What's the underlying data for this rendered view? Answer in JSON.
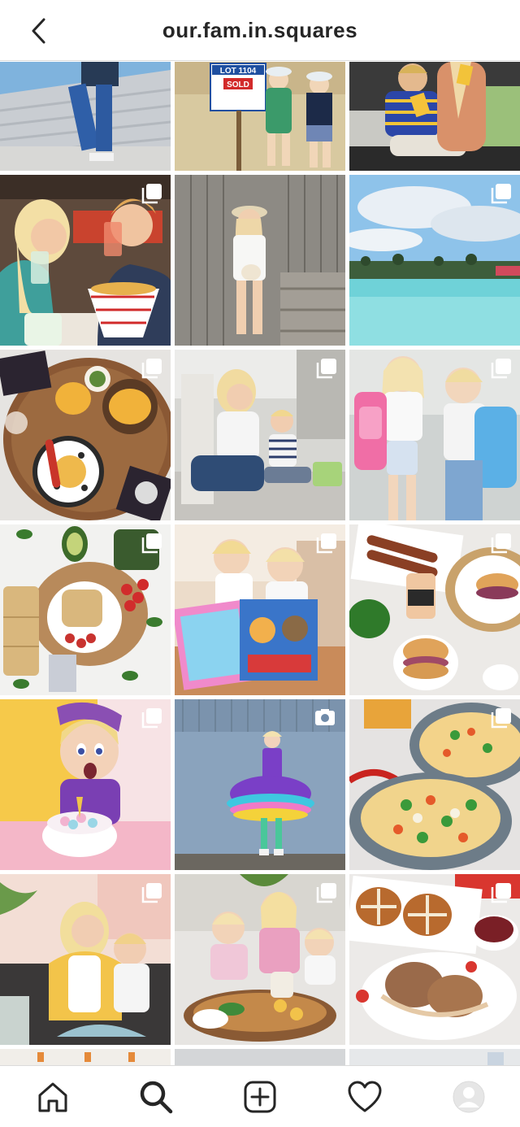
{
  "header": {
    "title": "our.fam.in.squares",
    "back_icon": "chevron-left-icon"
  },
  "grid": {
    "posts": [
      {
        "name": "post-woman-on-wall",
        "badge": "none"
      },
      {
        "name": "post-kids-sold-sign",
        "badge": "none",
        "sign_lot": "LOT 1104",
        "sign_status": "SOLD"
      },
      {
        "name": "post-kids-eating-snacks",
        "badge": "none"
      },
      {
        "name": "post-couple-drinks",
        "badge": "carousel"
      },
      {
        "name": "post-woman-wooden-wall",
        "badge": "none"
      },
      {
        "name": "post-lagoon-pool",
        "badge": "carousel"
      },
      {
        "name": "post-chips-platter",
        "badge": "carousel"
      },
      {
        "name": "post-mum-and-son-bench",
        "badge": "carousel"
      },
      {
        "name": "post-kids-school-bags",
        "badge": "carousel"
      },
      {
        "name": "post-avocado-toast",
        "badge": "carousel"
      },
      {
        "name": "post-kids-paw-patrol",
        "badge": "carousel"
      },
      {
        "name": "post-burgers-sausages",
        "badge": "carousel"
      },
      {
        "name": "post-girl-birthday-cake",
        "badge": "carousel"
      },
      {
        "name": "post-girl-tutu-dress",
        "badge": "video"
      },
      {
        "name": "post-noodle-bowls",
        "badge": "carousel"
      },
      {
        "name": "post-mum-daughter-couch",
        "badge": "carousel"
      },
      {
        "name": "post-family-feast",
        "badge": "carousel"
      },
      {
        "name": "post-hot-cross-buns",
        "badge": "carousel"
      }
    ]
  },
  "bottom_nav": [
    {
      "name": "nav-home",
      "icon": "home-icon"
    },
    {
      "name": "nav-search",
      "icon": "search-icon",
      "active": true
    },
    {
      "name": "nav-new-post",
      "icon": "add-post-icon"
    },
    {
      "name": "nav-activity",
      "icon": "heart-icon"
    },
    {
      "name": "nav-profile",
      "icon": "profile-avatar-icon"
    }
  ],
  "colors": {
    "header_text": "#262626",
    "divider": "#dbdbdb",
    "background": "#ffffff"
  }
}
